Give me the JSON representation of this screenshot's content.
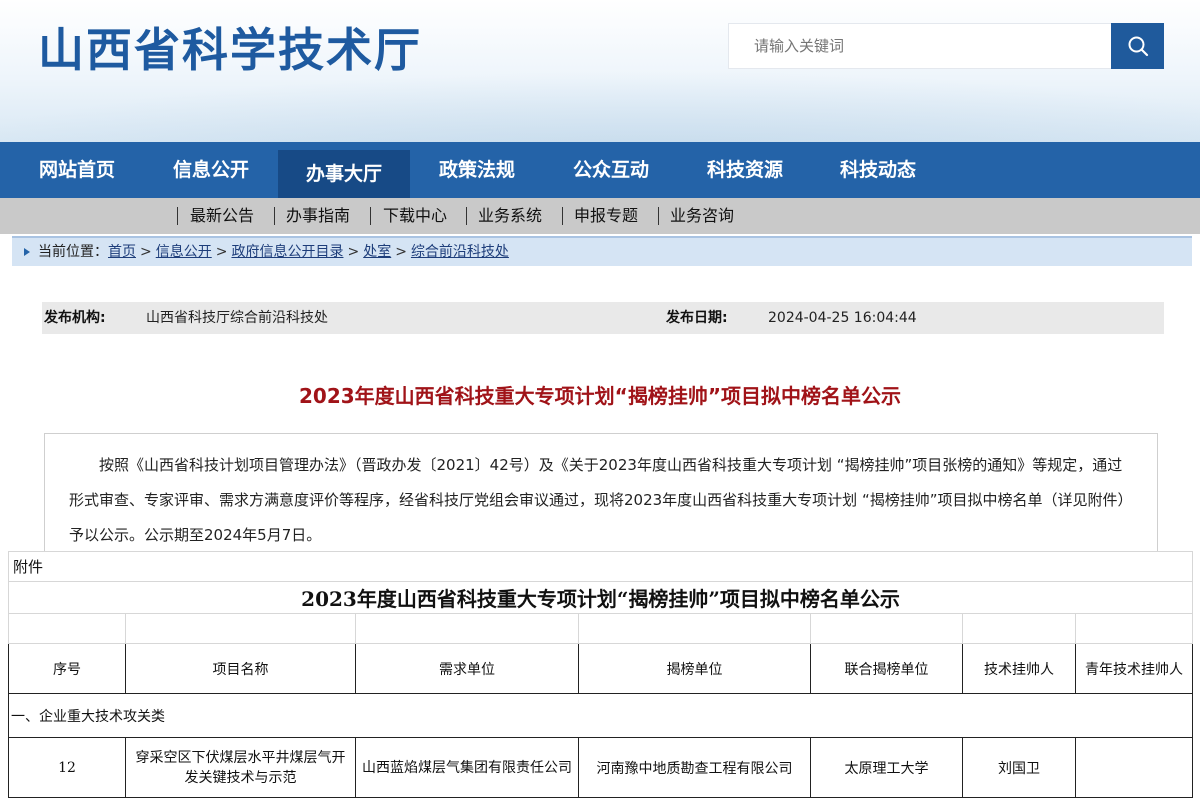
{
  "header": {
    "site_title": "山西省科学技术厅",
    "search_placeholder": "请输入关键词",
    "search_icon": "search-icon"
  },
  "main_nav": [
    "网站首页",
    "信息公开",
    "办事大厅",
    "政策法规",
    "公众互动",
    "科技资源",
    "科技动态"
  ],
  "main_nav_active": "办事大厅",
  "sub_nav": [
    "最新公告",
    "办事指南",
    "下载中心",
    "业务系统",
    "申报专题",
    "业务咨询"
  ],
  "breadcrumb": {
    "label": "当前位置：",
    "items": [
      "首页",
      "信息公开",
      "政府信息公开目录",
      "处室",
      "综合前沿科技处"
    ],
    "separator": ">"
  },
  "meta": {
    "publisher_label": "发布机构:",
    "publisher": "山西省科技厅综合前沿科技处",
    "date_label": "发布日期:",
    "date": "2024-04-25 16:04:44"
  },
  "article": {
    "title": "2023年度山西省科技重大专项计划“揭榜挂帅”项目拟中榜名单公示",
    "body": "按照《山西省科技计划项目管理办法》（晋政办发〔2021〕42号）及《关于2023年度山西省科技重大专项计划 “揭榜挂帅”项目张榜的通知》等规定，通过形式审查、专家评审、需求方满意度评价等程序，经省科技厅党组会审议通过，现将2023年度山西省科技重大专项计划 “揭榜挂帅”项目拟中榜名单（详见附件）予以公示。公示期至2024年5月7日。"
  },
  "attachment": {
    "label": "附件",
    "title": "2023年度山西省科技重大专项计划“揭榜挂帅”项目拟中榜名单公示",
    "headers": [
      "序号",
      "项目名称",
      "需求单位",
      "揭榜单位",
      "联合揭榜单位",
      "技术挂帅人",
      "青年技术挂帅人"
    ],
    "category": "一、企业重大技术攻关类",
    "rows": [
      {
        "no": "12",
        "project": "穿采空区下伏煤层水平井煤层气开发关键技术与示范",
        "demand_unit": "山西蓝焰煤层气集团有限责任公司",
        "winner_unit": "河南豫中地质勘查工程有限公司",
        "joint_unit": "太原理工大学",
        "tech_leader": "刘国卫",
        "young_leader": ""
      }
    ]
  },
  "colors": {
    "brand_blue": "#1e5aa0",
    "nav_blue": "#2463a8",
    "nav_active": "#174a86",
    "title_red": "#a01318"
  }
}
